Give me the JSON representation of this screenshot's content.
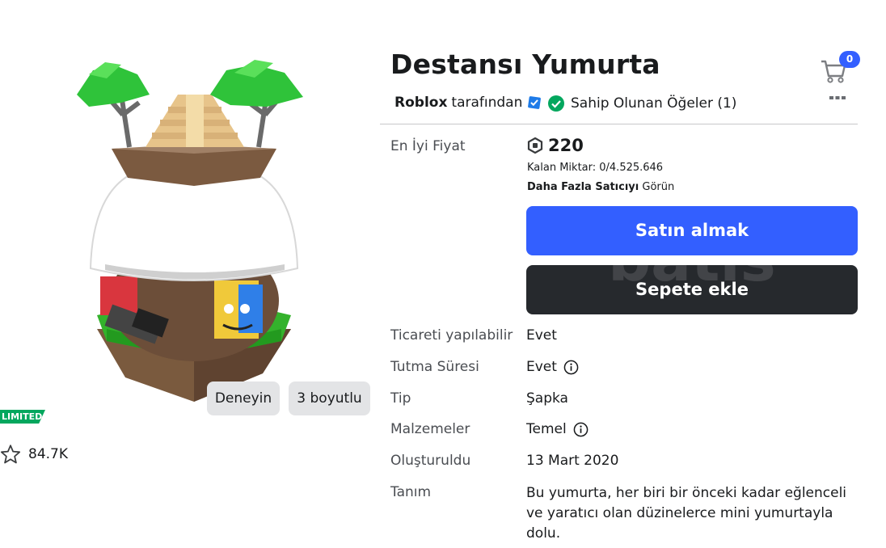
{
  "item": {
    "title": "Destansı Yumurta",
    "creator_name": "Roblox",
    "creator_suffix": "tarafından",
    "owned_text": "Sahip Olunan Öğeler (1)"
  },
  "image_actions": {
    "try_label": "Deneyin",
    "three_d_label": "3 boyutlu"
  },
  "badge": {
    "limited": "LIMITED"
  },
  "favorites": {
    "count": "84.7K"
  },
  "cart": {
    "count": "0"
  },
  "pricing": {
    "best_price_label": "En İyi Fiyat",
    "price": "220",
    "remaining": "Kalan Miktar: 0/4.525.646",
    "more_sellers_link": "Daha Fazla Satıcıyı",
    "more_sellers_suffix": "Görün"
  },
  "buttons": {
    "buy": "Satın almak",
    "add_to_cart": "Sepete ekle",
    "watermark": "batis"
  },
  "details": [
    {
      "label": "Ticareti yapılabilir",
      "value": "Evet"
    },
    {
      "label": "Tutma Süresi",
      "value": "Evet"
    },
    {
      "label": "Tip",
      "value": "Şapka"
    },
    {
      "label": "Malzemeler",
      "value": "Temel"
    },
    {
      "label": "Oluşturuldu",
      "value": "13 Mart 2020"
    },
    {
      "label": "Tanım",
      "value": "Bu yumurta, her biri bir önceki kadar eğlenceli ve yaratıcı olan düzinelerce mini yumurtayla dolu."
    }
  ],
  "colors": {
    "primary": "#335fff",
    "dark_button": "#26292d",
    "success_green": "#03a75e",
    "verified_blue": "#1e7be8"
  },
  "icons": [
    "robux-icon",
    "cart-icon",
    "verified-icon",
    "check-circle-icon",
    "info-icon",
    "star-icon",
    "more-icon"
  ]
}
